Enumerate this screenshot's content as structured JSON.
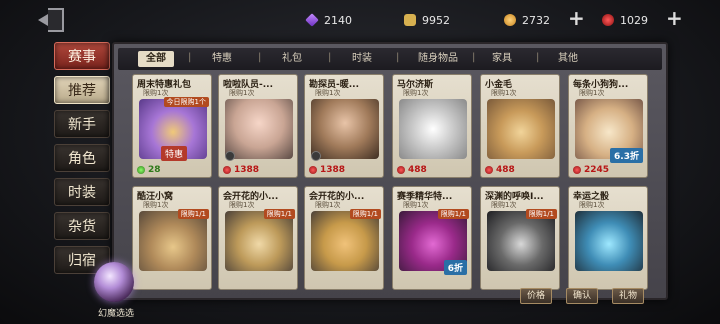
{
  "currencies": [
    {
      "icon": "purple-gem-icon",
      "value": "2140"
    },
    {
      "icon": "puzzle-icon",
      "value": "9952"
    },
    {
      "icon": "gold-coin-icon",
      "value": "2732"
    },
    {
      "icon": "red-gem-icon",
      "value": "1029"
    }
  ],
  "sidebar": {
    "tabs": [
      "赛事",
      "推荐",
      "新手",
      "角色",
      "时装",
      "杂货",
      "归宿"
    ]
  },
  "filters": [
    "全部",
    "特惠",
    "礼包",
    "时装",
    "随身物品",
    "家具",
    "其他"
  ],
  "cards": [
    {
      "title": "周末特惠礼包",
      "limit": "限购1次",
      "price": "28",
      "price_color": "green",
      "ribbon": "今日限购1个",
      "tag": "特惠"
    },
    {
      "title": "啦啦队员-...",
      "limit": "限购1次",
      "price": "1388"
    },
    {
      "title": "勘探员-暖...",
      "limit": "限购1次",
      "price": "1388"
    },
    {
      "title": "马尔济斯",
      "limit": "限购1次",
      "price": "488"
    },
    {
      "title": "小金毛",
      "limit": "限购1次",
      "price": "488"
    },
    {
      "title": "每条小狗狗...",
      "limit": "限购1次",
      "price": "2245",
      "discount": "6.3折"
    },
    {
      "title": "酷汪小窝",
      "limit": "限购1次",
      "price": "",
      "ribbon": "限购1/1"
    },
    {
      "title": "会开花的小...",
      "limit": "限购1次",
      "price": "",
      "ribbon": "限购1/1"
    },
    {
      "title": "会开花的小...",
      "limit": "限购1次",
      "price": "",
      "ribbon": "限购1/1"
    },
    {
      "title": "赛季精华特...",
      "limit": "限购1次",
      "price": "",
      "ribbon": "限购1/1",
      "discount": "6折"
    },
    {
      "title": "深渊的呼唤I...",
      "limit": "限购1次",
      "price": "",
      "ribbon": "限购1/1"
    },
    {
      "title": "幸运之骰",
      "limit": "限购1次",
      "price": ""
    }
  ],
  "bottom": {
    "btn1": "价格",
    "btn2": "确认",
    "btn3": "礼物",
    "orb_label": "幻魔选选"
  }
}
